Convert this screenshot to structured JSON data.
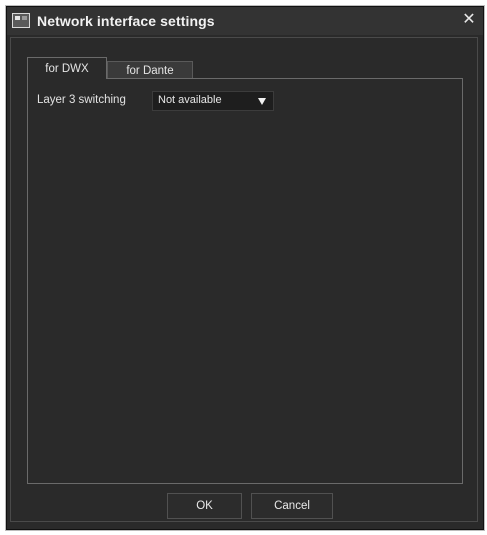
{
  "window": {
    "title": "Network interface settings",
    "close_symbol": "✕"
  },
  "tabs": [
    {
      "label": "for DWX",
      "selected": true
    },
    {
      "label": "for Dante",
      "selected": false
    }
  ],
  "settings": {
    "layer3_switching": {
      "label": "Layer 3 switching",
      "value": "Not available"
    }
  },
  "buttons": {
    "ok": "OK",
    "cancel": "Cancel"
  },
  "icons": {
    "app": "app-window-icon",
    "close": "close-icon",
    "dropdown": "chevron-down-icon"
  },
  "colors": {
    "window_background": "#2a2a2a",
    "titlebar": "#333333",
    "text": "#e6e6e6"
  }
}
